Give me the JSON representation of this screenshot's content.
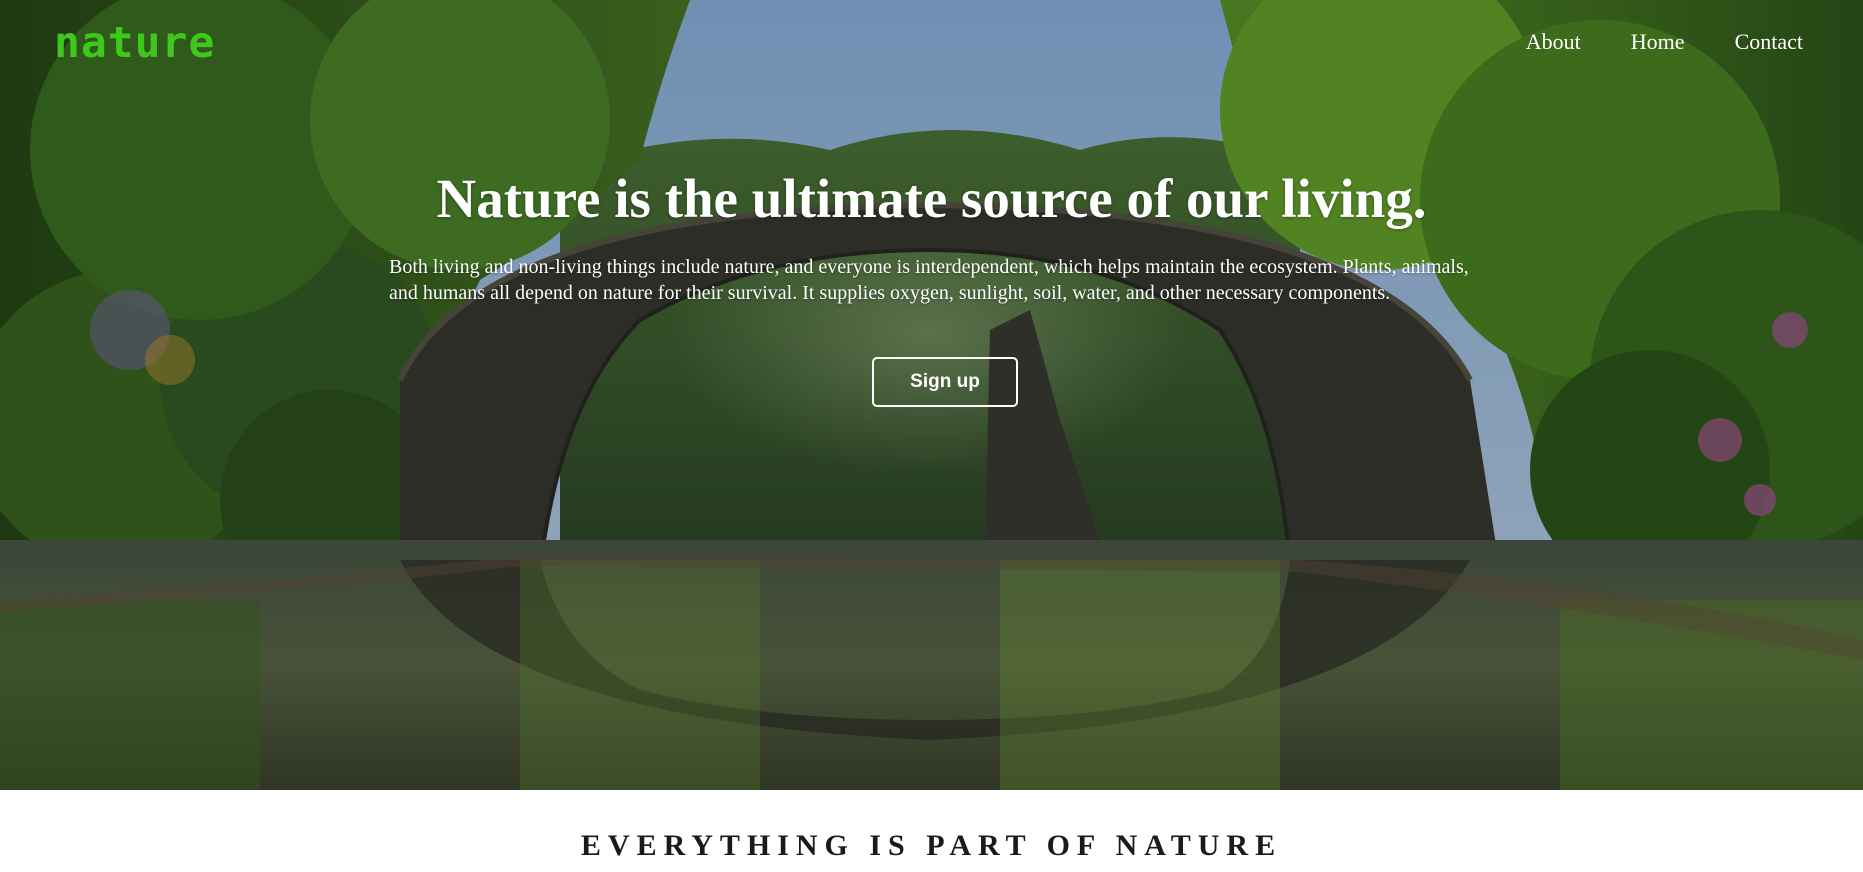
{
  "header": {
    "logo_text": "nature",
    "nav_items": [
      {
        "label": "About"
      },
      {
        "label": "Home"
      },
      {
        "label": "Contact"
      }
    ]
  },
  "hero": {
    "title": "Nature is the ultimate source of our living.",
    "paragraph": "Both living and non-living things include nature, and everyone is interdependent, which helps maintain the ecosystem. Plants, animals, and humans all depend on nature for their survival. It supplies oxygen, sunlight, soil, water, and other necessary components.",
    "cta_label": "Sign up",
    "background_image": "arch-bridge-over-forest-lake-photo"
  },
  "section": {
    "heading": "EVERYTHING IS PART OF NATURE"
  },
  "colors": {
    "logo": "#3ec81c",
    "nav_text": "#ffffff",
    "heading_dark": "#1a1a1a",
    "page_bg": "#ffffff"
  }
}
